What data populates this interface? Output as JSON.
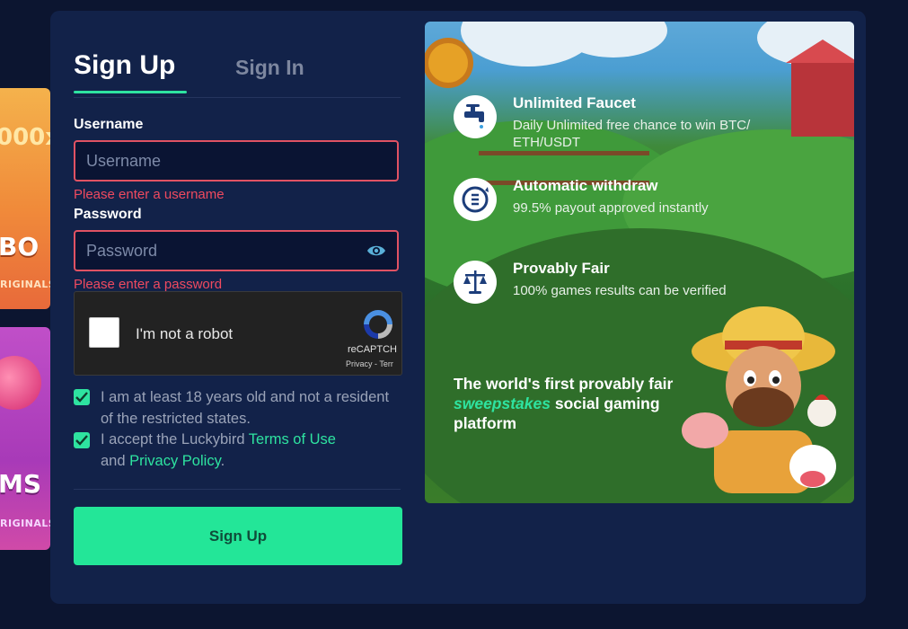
{
  "tabs": {
    "signup": "Sign Up",
    "signin": "Sign In"
  },
  "username": {
    "label": "Username",
    "placeholder": "Username",
    "error": "Please enter a username"
  },
  "password": {
    "label": "Password",
    "placeholder": "Password",
    "error": "Please enter a password"
  },
  "captcha": {
    "text": "I'm not a robot",
    "brand": "reCAPTCH",
    "links": "Privacy - Terr"
  },
  "agreements": {
    "age": "I am at least 18 years old and not a resident of the restricted states.",
    "terms_prefix": "I accept the Luckybird ",
    "terms_link": "Terms of Use",
    "terms_and": "and ",
    "privacy_link": "Privacy Policy",
    "terms_suffix": "."
  },
  "submit_label": "Sign Up",
  "promo": {
    "features": [
      {
        "title": "Unlimited Faucet",
        "desc": "Daily Unlimited free chance to win BTC/ ETH/USDT",
        "icon": "faucet-icon"
      },
      {
        "title": "Automatic withdraw",
        "desc": "99.5% payout approved instantly",
        "icon": "withdraw-icon"
      },
      {
        "title": "Provably Fair",
        "desc": "100% games results can be verified",
        "icon": "scales-icon"
      }
    ],
    "tagline_a": "The world's first provably fair ",
    "tagline_hl": "sweepstakes",
    "tagline_b": " social gaming platform"
  },
  "background_cards": [
    {
      "big": "BO",
      "small": "RIGINALS",
      "top": "000x"
    },
    {
      "big": "MS",
      "small": "RIGINALS"
    }
  ],
  "colors": {
    "accent": "#23e698",
    "error": "#f04a5f",
    "panel": "#122249"
  }
}
